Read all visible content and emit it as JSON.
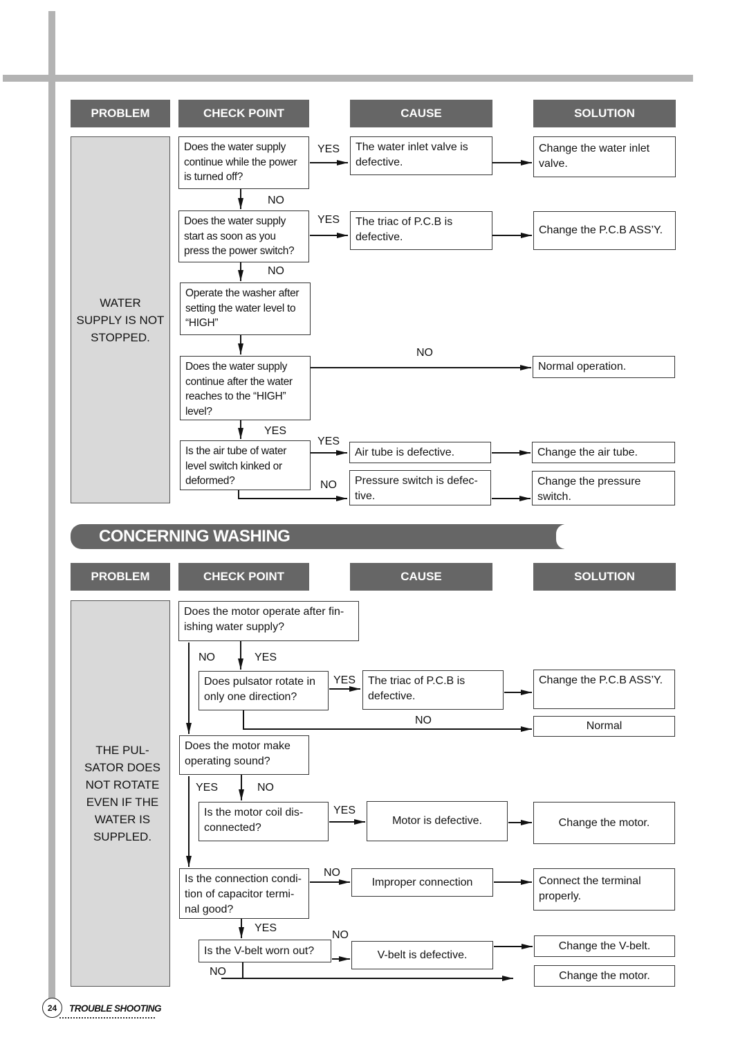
{
  "headers": {
    "problem": "PROBLEM",
    "check_point": "CHECK POINT",
    "cause": "CAUSE",
    "solution": "SOLUTION"
  },
  "section1": {
    "problem": "WATER SUPPLY IS NOT STOPPED.",
    "checks": [
      "Does the water supply continue while the power is turned off?",
      "Does the water supply start as soon as you press the power switch?",
      "Operate the washer after setting the water level to “HIGH”",
      "Does the water supply continue after the water reaches to the “HIGH” level?",
      "Is the air tube of water level switch kinked or deformed?"
    ],
    "causes": [
      "The water inlet valve is defective.",
      "The triac of P.C.B is defective.",
      "Air tube is defective.",
      "Pressure switch is defec- tive."
    ],
    "solutions": [
      "Change the water inlet valve.",
      "Change the P.C.B ASS’Y.",
      "Normal operation.",
      "Change the air tube.",
      "Change the pressure switch."
    ],
    "labels": {
      "yes1": "YES",
      "no1": "NO",
      "yes2": "YES",
      "no2": "NO",
      "no3": "NO",
      "yes4": "YES",
      "yes5": "YES",
      "no5": "NO"
    }
  },
  "banner": "CONCERNING WASHING",
  "section2": {
    "problem": "THE PUL- SATOR DOES NOT ROTATE EVEN IF THE WATER IS SUPPLED.",
    "checks": [
      "Does the motor operate after fin- ishing water supply?",
      "Does pulsator rotate in only one direction?",
      "Does the motor make operating sound?",
      "Is the  motor coil dis- connected?",
      "Is the connection condi- tion of capacitor termi- nal good?",
      "Is the V-belt worn out?"
    ],
    "causes": [
      "The triac of P.C.B is defective.",
      "Motor is defective.",
      "Improper connection",
      "V-belt is defective."
    ],
    "solutions": [
      "Change the P.C.B ASS’Y.",
      "Normal",
      "Change the motor.",
      "Connect the terminal properly.",
      "Change the V-belt.",
      "Change the motor."
    ],
    "labels": {
      "no1": "NO",
      "yes1": "YES",
      "yes2": "YES",
      "no2": "NO",
      "yes3": "YES",
      "no3": "NO",
      "yes4": "YES",
      "no5": "NO",
      "yes5": "YES",
      "no6": "NO",
      "no7": "NO"
    }
  },
  "footer": {
    "page_number": "24",
    "section": "TROUBLE SHOOTING"
  }
}
